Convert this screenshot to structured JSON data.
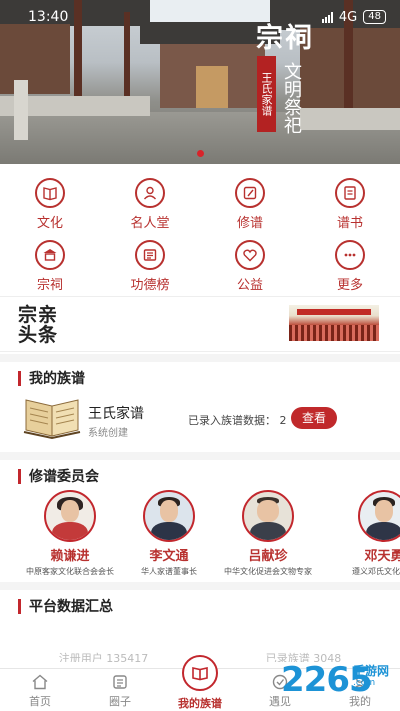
{
  "status_bar": {
    "time": "13:40",
    "network": "4G",
    "battery": "48"
  },
  "banner": {
    "big_text": "宗祠",
    "vertical_tag": "王氏家谱",
    "vertical_text": "文明祭祀",
    "dots": 2,
    "active_dot": 0
  },
  "features": [
    {
      "label": "文化",
      "icon": "book-icon"
    },
    {
      "label": "名人堂",
      "icon": "person-icon"
    },
    {
      "label": "修谱",
      "icon": "edit-icon"
    },
    {
      "label": "谱书",
      "icon": "document-icon"
    },
    {
      "label": "宗祠",
      "icon": "temple-icon"
    },
    {
      "label": "功德榜",
      "icon": "list-icon"
    },
    {
      "label": "公益",
      "icon": "heart-icon"
    },
    {
      "label": "更多",
      "icon": "more-icon"
    }
  ],
  "headline": {
    "logo_line1": "宗亲",
    "logo_line2": "头条"
  },
  "my_genealogy": {
    "title": "我的族谱",
    "name": "王氏家谱",
    "subtitle": "系统创建",
    "count_label": "已录入族谱数据：",
    "count": "2",
    "action": "查看"
  },
  "committee": {
    "title": "修谱委员会",
    "members": [
      {
        "name": "赖谦进",
        "title": "中原客家文化联合会会长"
      },
      {
        "name": "李文通",
        "title": "华人家谱董事长"
      },
      {
        "name": "吕献珍",
        "title": "中华文化促进会文物专家"
      },
      {
        "name": "邓天勇",
        "title": "遵义邓氏文化研究"
      }
    ]
  },
  "platform_stats": {
    "title": "平台数据汇总",
    "left": "注册用户 135417",
    "right": "已录族谱 3048"
  },
  "bottom_nav": [
    {
      "label": "首页",
      "icon": "home-icon"
    },
    {
      "label": "圈子",
      "icon": "circle-icon"
    },
    {
      "label": "我的族谱",
      "icon": "genealogy-icon",
      "active": true
    },
    {
      "label": "遇见",
      "icon": "meet-icon"
    },
    {
      "label": "我的",
      "icon": "profile-icon"
    }
  ],
  "watermark": {
    "number": "2265",
    "dot_com": ".com",
    "site_name": "手游网"
  },
  "colors": {
    "accent": "#c2272d",
    "text_red": "#b8312f",
    "gray_text": "#888888",
    "watermark_blue": "#1d93d6"
  }
}
